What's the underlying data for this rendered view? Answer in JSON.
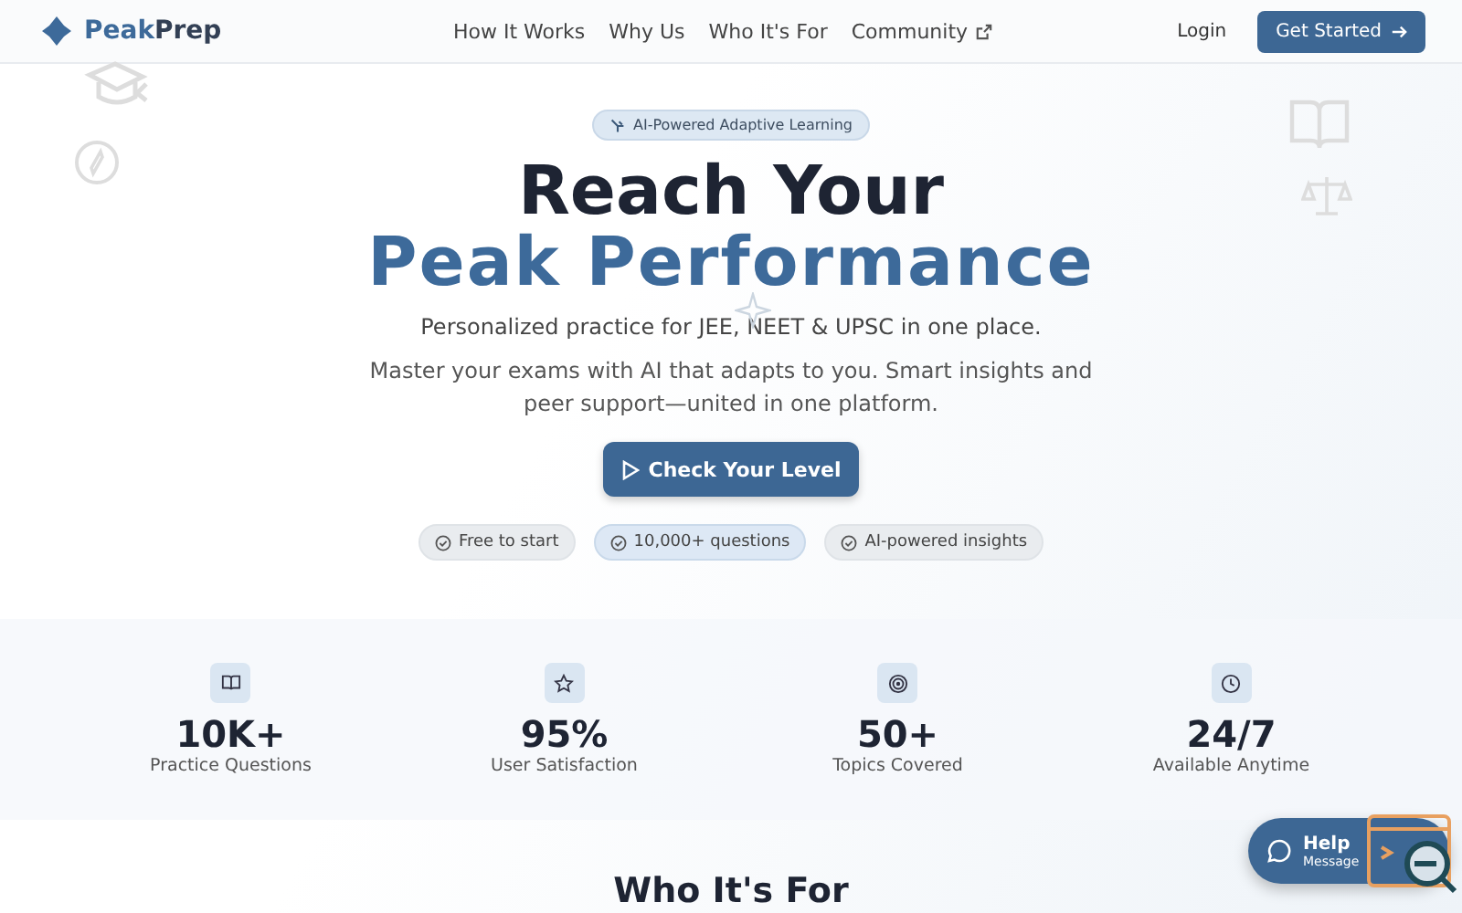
{
  "nav": {
    "brand": [
      "Peak",
      "Prep"
    ],
    "links": [
      {
        "label": "How It Works",
        "external": false
      },
      {
        "label": "Why Us",
        "external": false
      },
      {
        "label": "Who It's For",
        "external": false
      },
      {
        "label": "Community",
        "external": true
      }
    ],
    "login": "Login",
    "cta": "Get Started"
  },
  "hero": {
    "badge": "AI-Powered Adaptive Learning",
    "title_lines": [
      "Reach Your",
      "Peak Performance"
    ],
    "subtitle": "Personalized practice for JEE, NEET & UPSC in one place.",
    "body": "Master your exams with AI that adapts to you. Smart insights and peer support—united in one platform.",
    "button": "Check Your Level",
    "chips": [
      {
        "label": "Free to start",
        "selected": false
      },
      {
        "label": "10,000+ questions",
        "selected": true
      },
      {
        "label": "AI-powered insights",
        "selected": false
      }
    ]
  },
  "stats": [
    {
      "kind": "book",
      "value": "10K+",
      "label": "Practice Questions"
    },
    {
      "kind": "star",
      "value": "95%",
      "label": "User Satisfaction"
    },
    {
      "kind": "target",
      "value": "50+",
      "label": "Topics Covered"
    },
    {
      "kind": "clock",
      "value": "24/7",
      "label": "Available Anytime"
    }
  ],
  "next_heading": "Who It's For",
  "help": {
    "title": "Help",
    "subtitle": "Message"
  }
}
